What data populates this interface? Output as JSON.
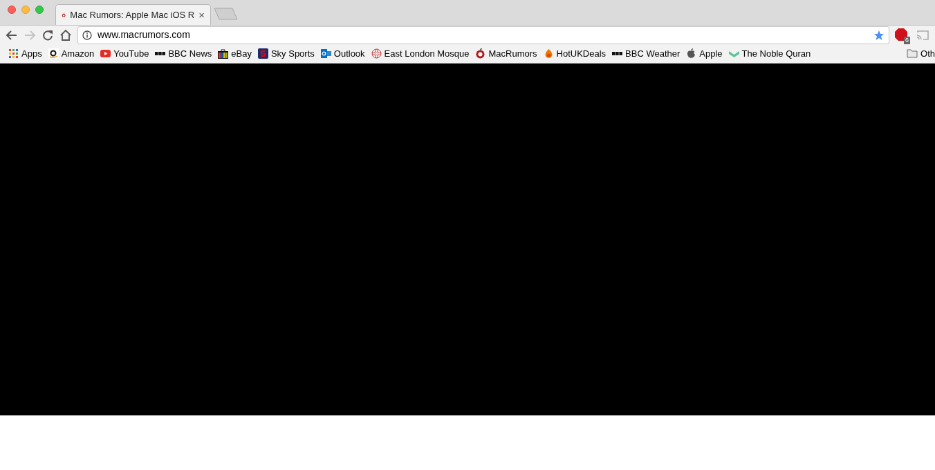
{
  "tab": {
    "title": "Mac Rumors: Apple Mac iOS R",
    "close": "×",
    "selected": true
  },
  "address_bar": {
    "value": "www.macrumors.com",
    "bookmarked": true
  },
  "extension_badge": "6",
  "bookmarks": [
    {
      "kind": "apps",
      "label": "Apps"
    },
    {
      "kind": "amazon",
      "label": "Amazon"
    },
    {
      "kind": "youtube",
      "label": "YouTube"
    },
    {
      "kind": "bbc",
      "label": "BBC News"
    },
    {
      "kind": "ebay",
      "label": "eBay"
    },
    {
      "kind": "sky",
      "label": "Sky Sports"
    },
    {
      "kind": "outlook",
      "label": "Outlook"
    },
    {
      "kind": "flower",
      "label": "East London Mosque"
    },
    {
      "kind": "macrumors",
      "label": "MacRumors"
    },
    {
      "kind": "flame",
      "label": "HotUKDeals"
    },
    {
      "kind": "bbc",
      "label": "BBC Weather"
    },
    {
      "kind": "apple",
      "label": "Apple"
    },
    {
      "kind": "book",
      "label": "The Noble Quran"
    }
  ],
  "other_bookmarks": "Oth"
}
